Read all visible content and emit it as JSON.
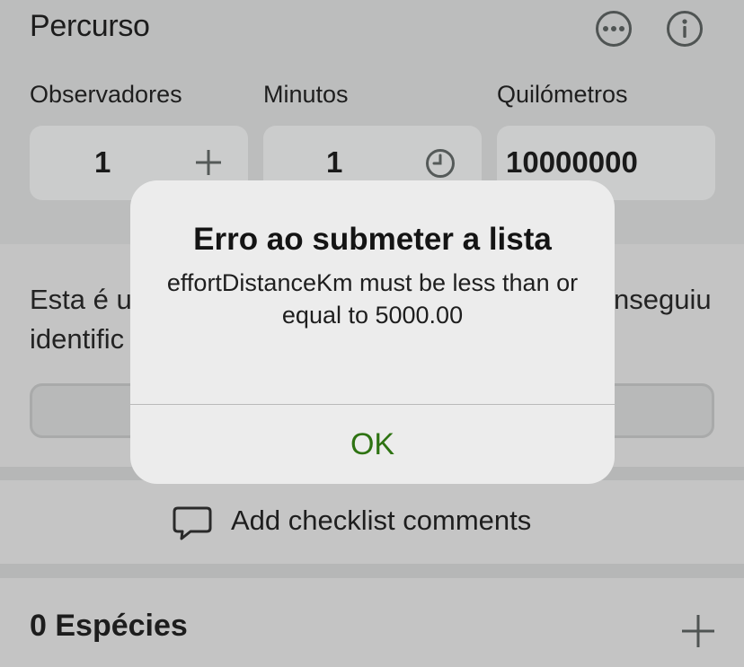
{
  "header": {
    "title": "Percurso",
    "more_icon": "ellipsis-circle-icon",
    "info_icon": "info-circle-icon"
  },
  "fields": [
    {
      "label": "Observadores",
      "value": "1",
      "icon": "plus-icon"
    },
    {
      "label": "Minutos",
      "value": "1",
      "icon": "clock-icon"
    },
    {
      "label": "Quilómetros",
      "value": "10000000"
    }
  ],
  "middle": {
    "text_line1_left": "Esta é u",
    "text_line1_right": "nseguiu",
    "text_line2_left": "identific"
  },
  "comments": {
    "label": "Add checklist comments",
    "icon": "speech-bubble-icon"
  },
  "species": {
    "title": "0 Espécies",
    "add_icon": "plus-icon"
  },
  "alert": {
    "title": "Erro ao submeter a lista",
    "message": "effortDistanceKm must be less than or equal to 5000.00",
    "ok_label": "OK"
  },
  "colors": {
    "accent_green": "#2e7312",
    "alert_bg": "#ececec",
    "dim_bg": "#c4c4c4"
  }
}
